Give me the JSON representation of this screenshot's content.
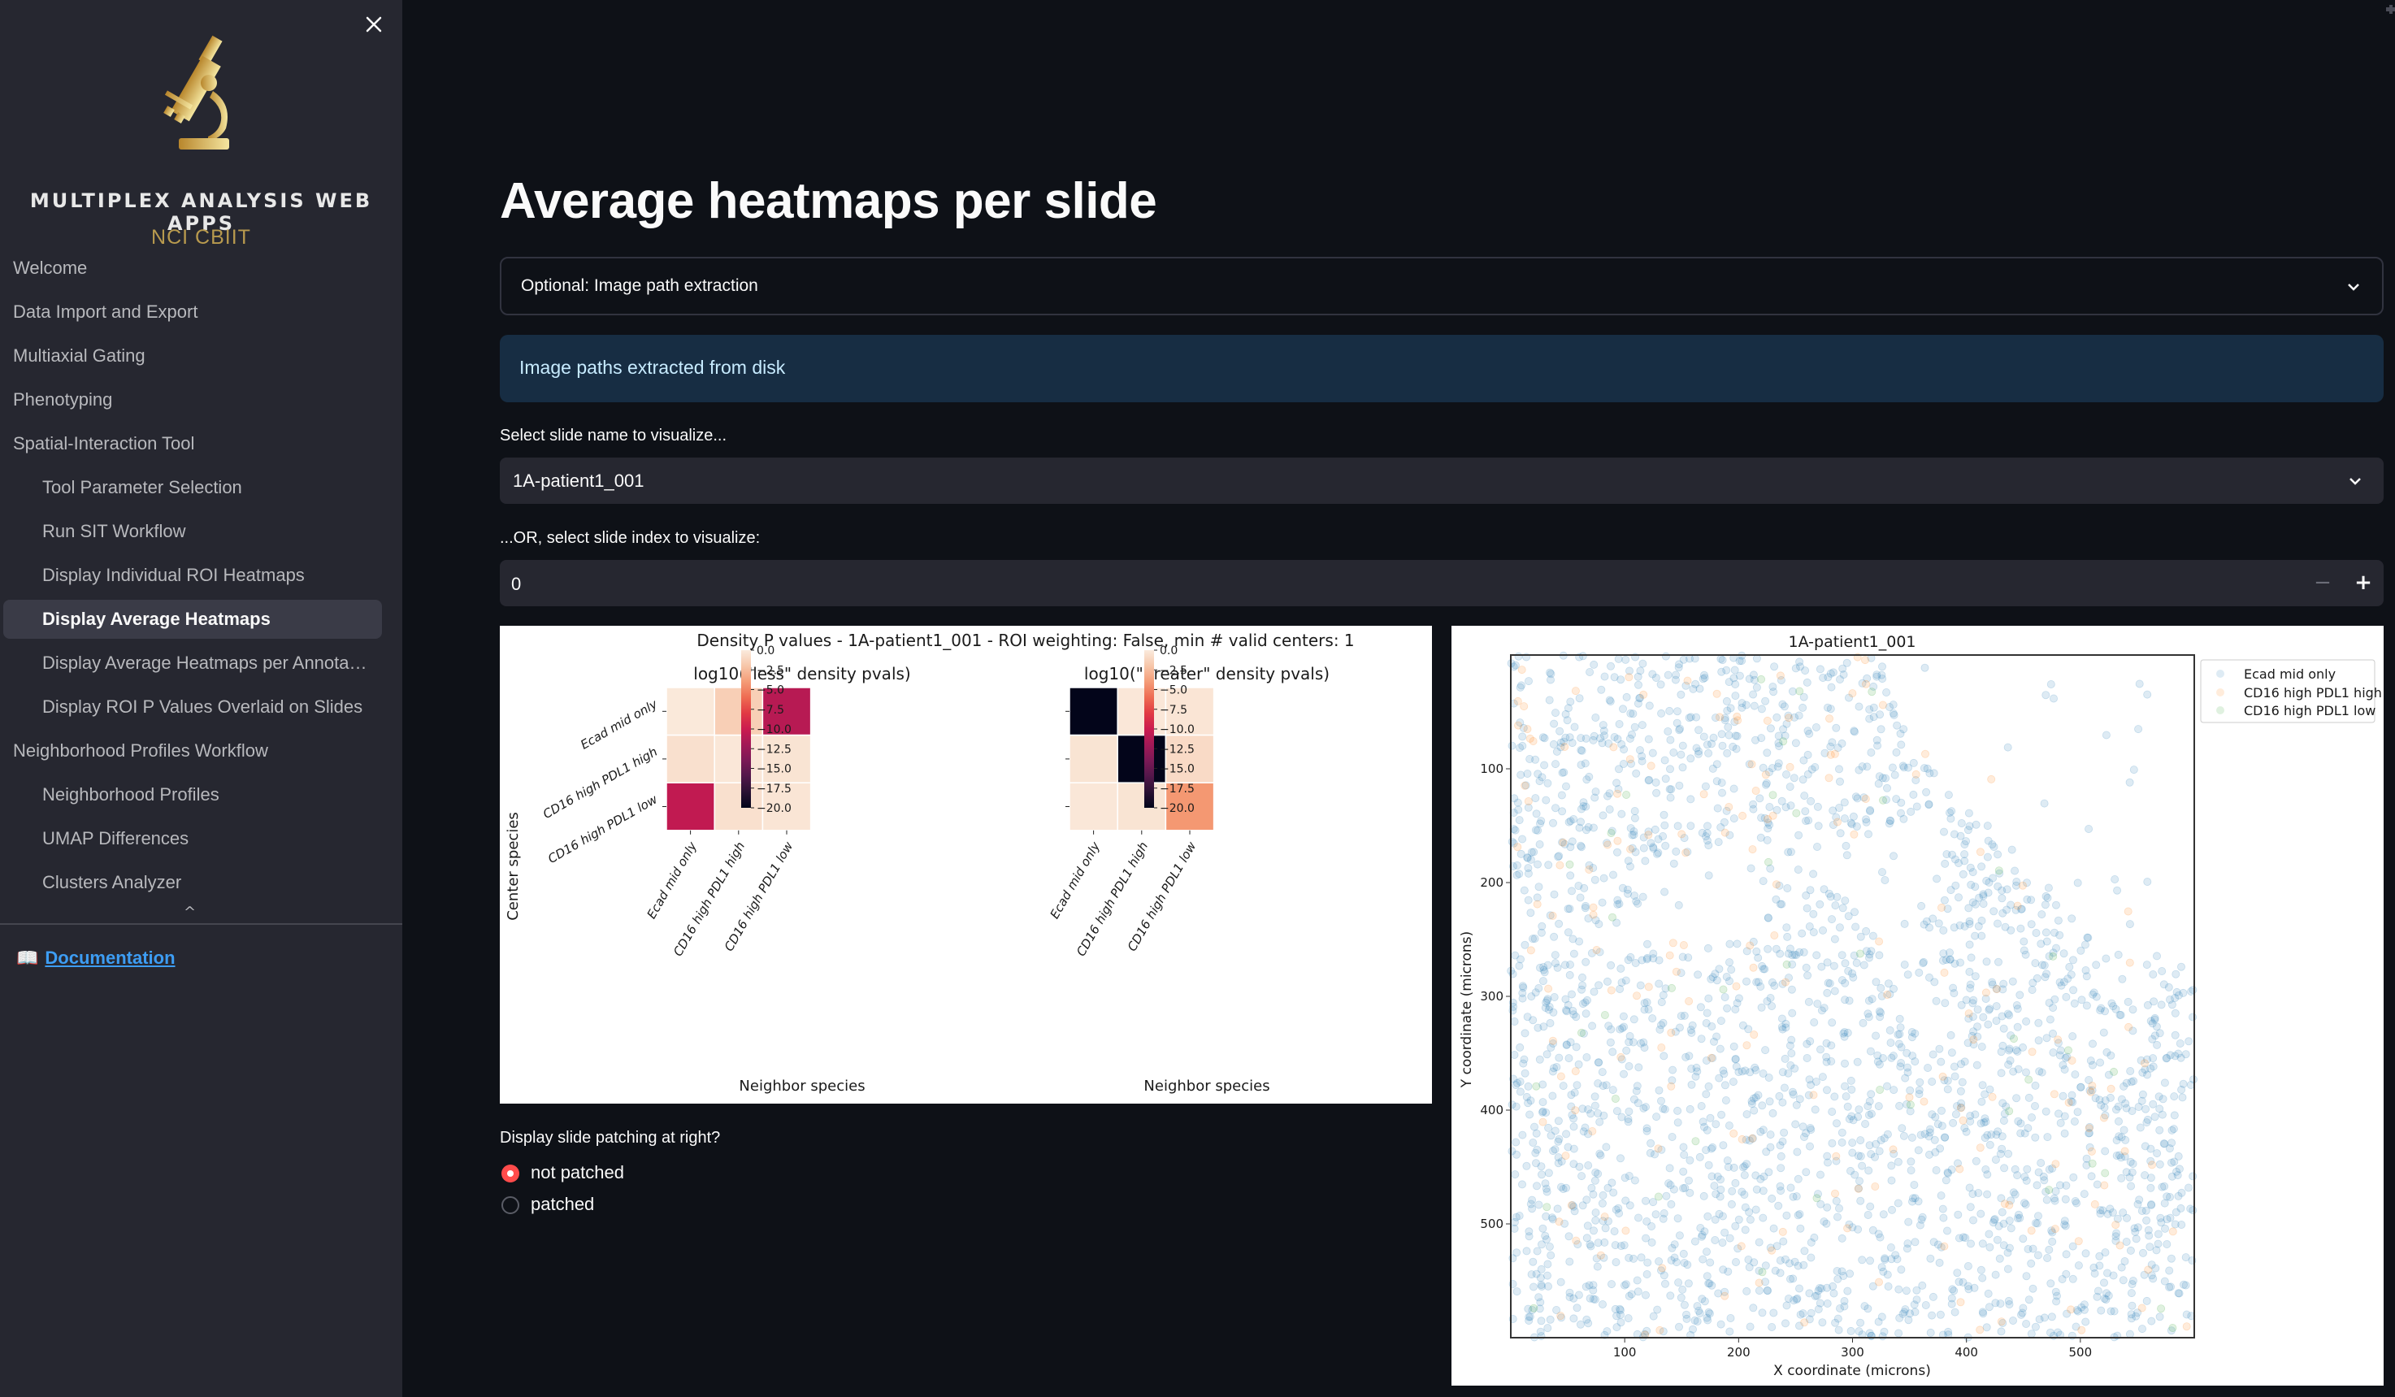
{
  "sidebar": {
    "logo": {
      "title": "MULTIPLEX ANALYSIS WEB APPS",
      "subtitle": "NCI CBIIT",
      "icon": "microscope-icon"
    },
    "close_icon": "close-icon",
    "items": [
      {
        "label": "Welcome",
        "level": 0,
        "active": false
      },
      {
        "label": "Data Import and Export",
        "level": 0,
        "active": false
      },
      {
        "label": "Multiaxial Gating",
        "level": 0,
        "active": false
      },
      {
        "label": "Phenotyping",
        "level": 0,
        "active": false
      },
      {
        "label": "Spatial-Interaction Tool",
        "level": 0,
        "active": false
      },
      {
        "label": "Tool Parameter Selection",
        "level": 1,
        "active": false
      },
      {
        "label": "Run SIT Workflow",
        "level": 1,
        "active": false
      },
      {
        "label": "Display Individual ROI Heatmaps",
        "level": 1,
        "active": false
      },
      {
        "label": "Display Average Heatmaps",
        "level": 1,
        "active": true
      },
      {
        "label": "Display Average Heatmaps per Annota…",
        "level": 1,
        "active": false
      },
      {
        "label": "Display ROI P Values Overlaid on Slides",
        "level": 1,
        "active": false
      },
      {
        "label": "Neighborhood Profiles Workflow",
        "level": 0,
        "active": false
      },
      {
        "label": "Neighborhood Profiles",
        "level": 1,
        "active": false
      },
      {
        "label": "UMAP Differences",
        "level": 1,
        "active": false
      },
      {
        "label": "Clusters Analyzer",
        "level": 1,
        "active": false
      }
    ],
    "scroll_caret": "^",
    "doc_link": {
      "icon": "📖",
      "label": "Documentation"
    }
  },
  "main": {
    "title": "Average heatmaps per slide",
    "expander": {
      "label": "Optional: Image path extraction",
      "expanded": false
    },
    "info": "Image paths extracted from disk",
    "slide_select": {
      "label": "Select slide name to visualize...",
      "value": "1A-patient1_001"
    },
    "slide_index": {
      "label": "...OR, select slide index to visualize:",
      "value": "0",
      "minus": "−",
      "plus": "+"
    },
    "patching": {
      "label": "Display slide patching at right?",
      "options": [
        {
          "label": "not patched",
          "selected": true
        },
        {
          "label": "patched",
          "selected": false
        }
      ]
    }
  },
  "colors": {
    "sidebar_bg": "#262730",
    "main_bg": "#0e1117",
    "accent": "#ff4b4b",
    "info_bg": "#172d43",
    "link": "#3d9df3",
    "logo_gold": "#b89a4e"
  },
  "chart_data": [
    {
      "type": "heatmap",
      "title": "Density P values - 1A-patient1_001 - ROI weighting: False, min # valid centers: 1",
      "panels": [
        {
          "title": "log10(\"less\" density pvals)",
          "ylabel": "Center species",
          "xlabel": "Neighbor species",
          "rows": [
            "Ecad mid only",
            "CD16 high PDL1 high",
            "CD16 high PDL1 low"
          ],
          "cols": [
            "Ecad mid only",
            "CD16 high PDL1 high",
            "CD16 high PDL1 low"
          ],
          "values": [
            [
              -0.1,
              -1.5,
              -11.0
            ],
            [
              -0.6,
              -0.2,
              -0.4
            ],
            [
              -10.5,
              -0.6,
              -0.3
            ]
          ],
          "colorbar": {
            "range": [
              -20.0,
              0.0
            ],
            "ticks": [
              "0.0",
              "−2.5",
              "−5.0",
              "−7.5",
              "−10.0",
              "−12.5",
              "−15.0",
              "−17.5",
              "−20.0"
            ],
            "colormap": "rocket_r"
          }
        },
        {
          "title": "log10(\"greater\" density pvals)",
          "ylabel": "",
          "xlabel": "Neighbor species",
          "rows": [
            "Ecad mid only",
            "CD16 high PDL1 high",
            "CD16 high PDL1 low"
          ],
          "cols": [
            "Ecad mid only",
            "CD16 high PDL1 high",
            "CD16 high PDL1 low"
          ],
          "values": [
            [
              -20.0,
              -0.2,
              -0.3
            ],
            [
              -0.4,
              -20.0,
              -0.9
            ],
            [
              -0.2,
              -0.4,
              -4.2
            ]
          ],
          "colorbar": {
            "range": [
              -20.0,
              0.0
            ],
            "ticks": [
              "0.0",
              "−2.5",
              "−5.0",
              "−7.5",
              "−10.0",
              "−12.5",
              "−15.0",
              "−17.5",
              "−20.0"
            ],
            "colormap": "rocket_r"
          }
        }
      ]
    },
    {
      "type": "scatter",
      "title": "1A-patient1_001",
      "xlabel": "X coordinate (microns)",
      "ylabel": "Y coordinate (microns)",
      "xlim": [
        0,
        600
      ],
      "ylim": [
        600,
        0
      ],
      "xticks": [
        100,
        200,
        300,
        400,
        500
      ],
      "yticks": [
        100,
        200,
        300,
        400,
        500
      ],
      "legend_position": "outside-top-right",
      "series": [
        {
          "name": "Ecad mid only",
          "color": "#1f77b4",
          "approx_count": 2400
        },
        {
          "name": "CD16 high PDL1 high",
          "color": "#ff7f0e",
          "approx_count": 180
        },
        {
          "name": "CD16 high PDL1 low",
          "color": "#2ca02c",
          "approx_count": 40
        }
      ],
      "marker_alpha": 0.15
    }
  ]
}
